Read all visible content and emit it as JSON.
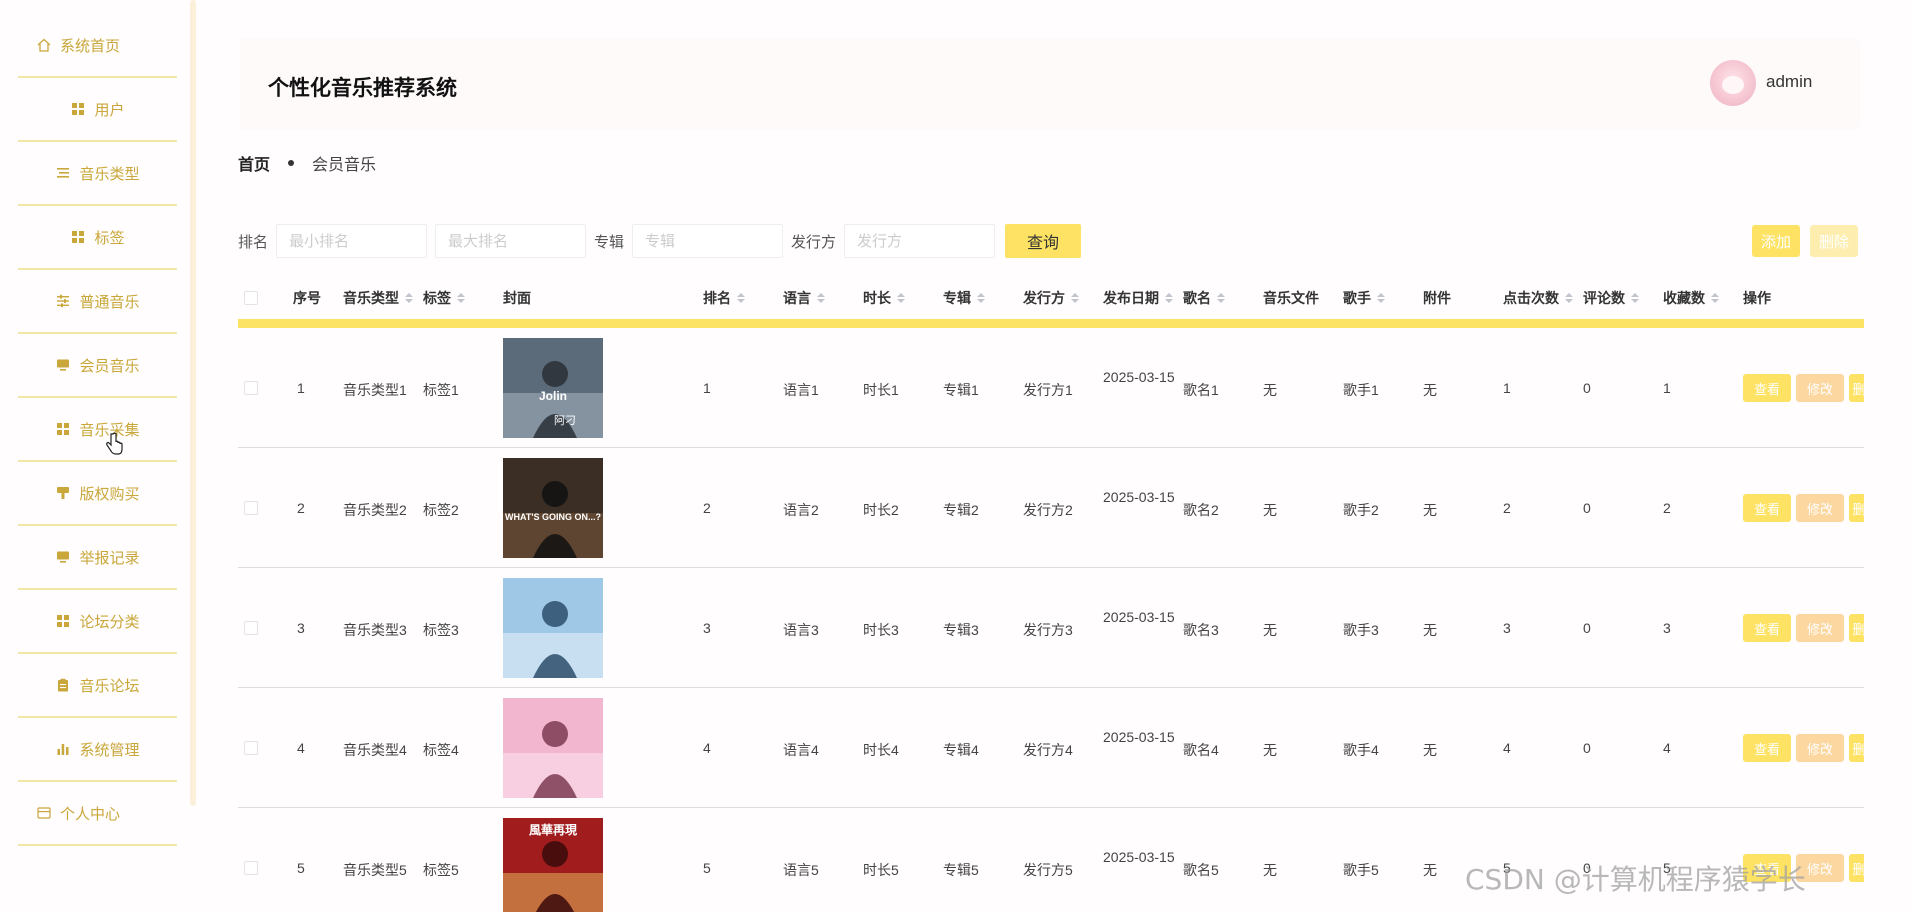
{
  "sidebar": {
    "items": [
      {
        "label": "系统首页",
        "icon": "home-icon"
      },
      {
        "label": "用户",
        "icon": "grid-icon"
      },
      {
        "label": "音乐类型",
        "icon": "list-icon"
      },
      {
        "label": "标签",
        "icon": "grid-icon"
      },
      {
        "label": "普通音乐",
        "icon": "sliders-icon"
      },
      {
        "label": "会员音乐",
        "icon": "monitor-icon"
      },
      {
        "label": "音乐采集",
        "icon": "grid-icon"
      },
      {
        "label": "版权购买",
        "icon": "stamp-icon"
      },
      {
        "label": "举报记录",
        "icon": "monitor-icon"
      },
      {
        "label": "论坛分类",
        "icon": "grid-icon"
      },
      {
        "label": "音乐论坛",
        "icon": "clipboard-icon"
      },
      {
        "label": "系统管理",
        "icon": "bar-chart-icon"
      },
      {
        "label": "个人中心",
        "icon": "card-icon"
      }
    ]
  },
  "header": {
    "title": "个性化音乐推荐系统",
    "user": "admin"
  },
  "breadcrumb": {
    "home": "首页",
    "current": "会员音乐"
  },
  "search": {
    "rank_label": "排名",
    "min_rank_placeholder": "最小排名",
    "max_rank_placeholder": "最大排名",
    "album_label": "专辑",
    "album_placeholder": "专辑",
    "publisher_label": "发行方",
    "publisher_placeholder": "发行方",
    "query_button": "查询",
    "add_button": "添加",
    "delete_button": "删除"
  },
  "table": {
    "headers": {
      "index": "序号",
      "type": "音乐类型",
      "tag": "标签",
      "cover": "封面",
      "rank": "排名",
      "language": "语言",
      "duration": "时长",
      "album": "专辑",
      "publisher": "发行方",
      "release_date": "发布日期",
      "song": "歌名",
      "music_file": "音乐文件",
      "singer": "歌手",
      "attachment": "附件",
      "clicks": "点击次数",
      "comments": "评论数",
      "favorites": "收藏数",
      "actions": "操作"
    },
    "action_labels": {
      "view": "查看",
      "edit": "修改",
      "more": "删"
    },
    "rows": [
      {
        "index": "1",
        "type": "音乐类型1",
        "tag": "标签1",
        "rank": "1",
        "language": "语言1",
        "duration": "时长1",
        "album": "专辑1",
        "publisher": "发行方1",
        "release_date": "2025-03-15",
        "song": "歌名1",
        "music_file": "无",
        "singer": "歌手1",
        "attachment": "无",
        "clicks": "1",
        "comments": "0",
        "favorites": "1"
      },
      {
        "index": "2",
        "type": "音乐类型2",
        "tag": "标签2",
        "rank": "2",
        "language": "语言2",
        "duration": "时长2",
        "album": "专辑2",
        "publisher": "发行方2",
        "release_date": "2025-03-15",
        "song": "歌名2",
        "music_file": "无",
        "singer": "歌手2",
        "attachment": "无",
        "clicks": "2",
        "comments": "0",
        "favorites": "2"
      },
      {
        "index": "3",
        "type": "音乐类型3",
        "tag": "标签3",
        "rank": "3",
        "language": "语言3",
        "duration": "时长3",
        "album": "专辑3",
        "publisher": "发行方3",
        "release_date": "2025-03-15",
        "song": "歌名3",
        "music_file": "无",
        "singer": "歌手3",
        "attachment": "无",
        "clicks": "3",
        "comments": "0",
        "favorites": "3"
      },
      {
        "index": "4",
        "type": "音乐类型4",
        "tag": "标签4",
        "rank": "4",
        "language": "语言4",
        "duration": "时长4",
        "album": "专辑4",
        "publisher": "发行方4",
        "release_date": "2025-03-15",
        "song": "歌名4",
        "music_file": "无",
        "singer": "歌手4",
        "attachment": "无",
        "clicks": "4",
        "comments": "0",
        "favorites": "4"
      },
      {
        "index": "5",
        "type": "音乐类型5",
        "tag": "标签5",
        "rank": "5",
        "language": "语言5",
        "duration": "时长5",
        "album": "专辑5",
        "publisher": "发行方5",
        "release_date": "2025-03-15",
        "song": "歌名5",
        "music_file": "无",
        "singer": "歌手5",
        "attachment": "无",
        "clicks": "5",
        "comments": "0",
        "favorites": "5"
      }
    ]
  },
  "covers": [
    {
      "text": "Jolin",
      "subtext": "阿刁"
    },
    {
      "text": "WHAT'S GOING ON...?",
      "subtext": ""
    },
    {
      "text": "",
      "subtext": ""
    },
    {
      "text": "",
      "subtext": ""
    },
    {
      "text": "風華再現",
      "subtext": ""
    }
  ],
  "watermark": "CSDN @计算机程序猿学长",
  "colors": {
    "accent": "#fde263",
    "accent_light": "#fcd7a0",
    "sidebar_text": "#c9a73a",
    "header_bar": "#fce363"
  }
}
